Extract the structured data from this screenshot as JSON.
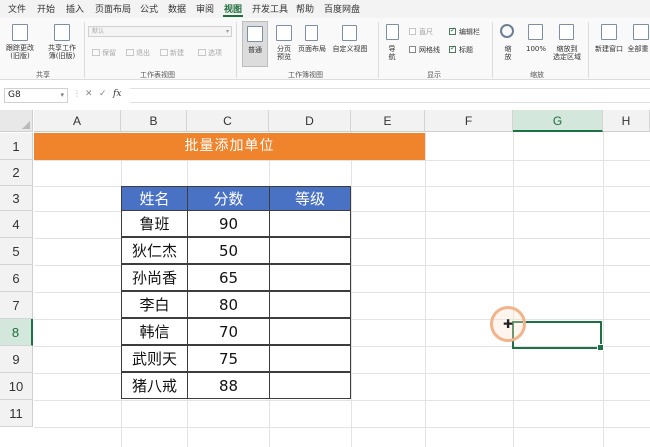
{
  "menu": {
    "items": [
      "文件",
      "开始",
      "插入",
      "页面布局",
      "公式",
      "数据",
      "审阅",
      "视图",
      "开发工具",
      "帮助",
      "百度网盘"
    ],
    "active": "视图"
  },
  "ribbon": {
    "share": {
      "track_changes": "跟踪更改\n(旧版)",
      "share_workbook": "共享工作\n簿(旧版)",
      "group": "共享"
    },
    "sheet_view": {
      "dropdown_value": "默认",
      "keep": "保留",
      "exit": "退出",
      "new": "新建",
      "options": "选项",
      "group": "工作表视图"
    },
    "workbook_views": {
      "normal": "普通",
      "page_break": "分页\n预览",
      "page_layout": "页面布局",
      "custom_views": "自定义视图",
      "group": "工作簿视图"
    },
    "show": {
      "navigation": "导\n航",
      "ruler": "直尺",
      "formula_bar": "编辑栏",
      "gridlines": "网格线",
      "headings": "标题",
      "group": "显示"
    },
    "zoom": {
      "zoom": "缩\n放",
      "hundred": "100%",
      "zoom_selection": "缩放到\n选定区域",
      "group": "缩放"
    },
    "window": {
      "new_window": "新建窗口",
      "arrange_all": "全部重"
    }
  },
  "formula_bar": {
    "name_box": "G8",
    "cancel": "✕",
    "enter": "✓",
    "fx": "fx",
    "value": ""
  },
  "grid": {
    "columns": [
      "A",
      "B",
      "C",
      "D",
      "E",
      "F",
      "G",
      "H"
    ],
    "rows": [
      "1",
      "2",
      "3",
      "4",
      "5",
      "6",
      "7",
      "8",
      "9",
      "10",
      "11"
    ],
    "selected_col": "G",
    "selected_row": "8",
    "active_cell": "G8"
  },
  "banner": "批量添加单位",
  "table": {
    "headers": [
      "姓名",
      "分数",
      "等级"
    ],
    "rows": [
      [
        "鲁班",
        "90",
        ""
      ],
      [
        "狄仁杰",
        "50",
        ""
      ],
      [
        "孙尚香",
        "65",
        ""
      ],
      [
        "李白",
        "80",
        ""
      ],
      [
        "韩信",
        "70",
        ""
      ],
      [
        "武则天",
        "75",
        ""
      ],
      [
        "猪八戒",
        "88",
        ""
      ]
    ]
  },
  "colors": {
    "accent_green": "#1e6e3c",
    "banner_orange": "#f0842c",
    "table_header_blue": "#4a72c4",
    "selection_green": "#1e7145"
  }
}
